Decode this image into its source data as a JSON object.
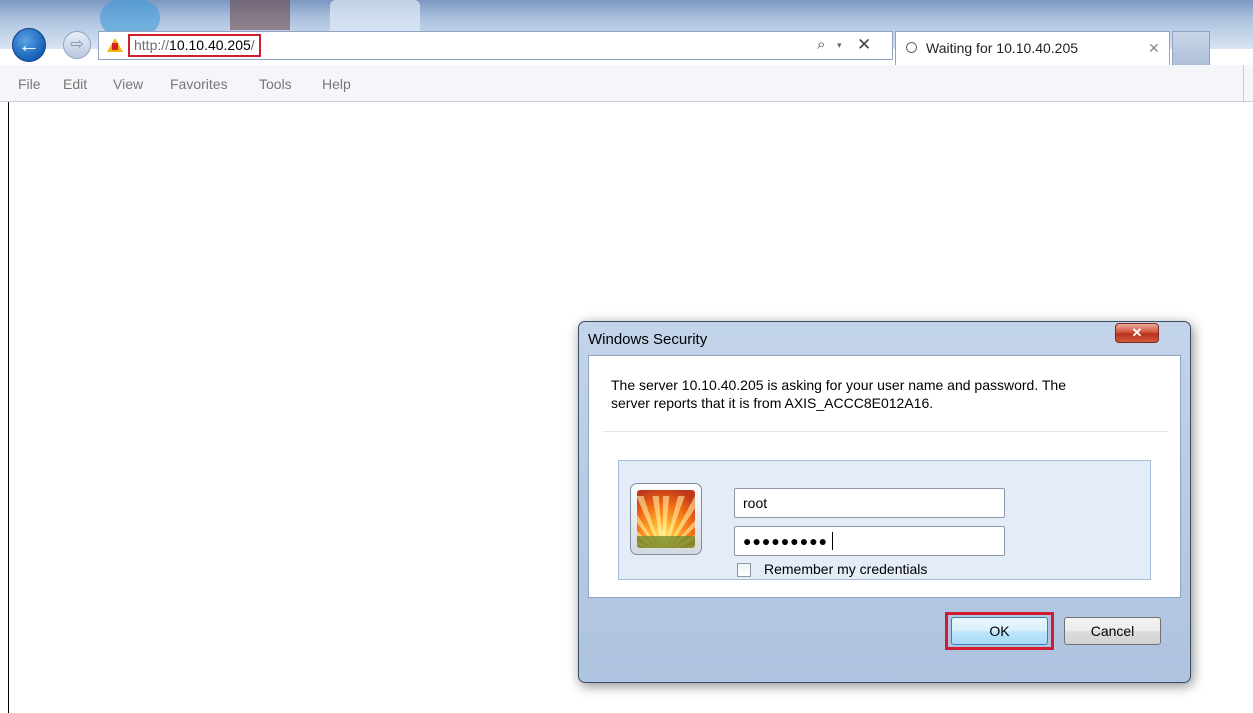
{
  "browser": {
    "url_prefix": "http://",
    "url_host": "10.10.40.205",
    "url_suffix": "/",
    "tab_title": "Waiting for 10.10.40.205",
    "nav": {
      "back_icon": "←",
      "forward_icon": "⇨",
      "search_icon": "⌕",
      "dropdown_icon": "▾",
      "stop_icon": "✕",
      "tab_close_icon": "✕"
    },
    "menu": [
      "File",
      "Edit",
      "View",
      "Favorites",
      "Tools",
      "Help"
    ]
  },
  "dialog": {
    "title": "Windows Security",
    "close_glyph": "✕",
    "message_line1": "The server 10.10.40.205 is asking for your user name and password. The",
    "message_line2": "server reports that it is from AXIS_ACCC8E012A16.",
    "username": "root",
    "password_masked": "●●●●●●●●●",
    "remember_label": "Remember my credentials",
    "remember_checked": false,
    "ok_label": "OK",
    "cancel_label": "Cancel"
  },
  "colors": {
    "highlight": "#d01e2e",
    "dialog_frame": "#b8cbe4",
    "accent_blue": "#1660b8"
  }
}
